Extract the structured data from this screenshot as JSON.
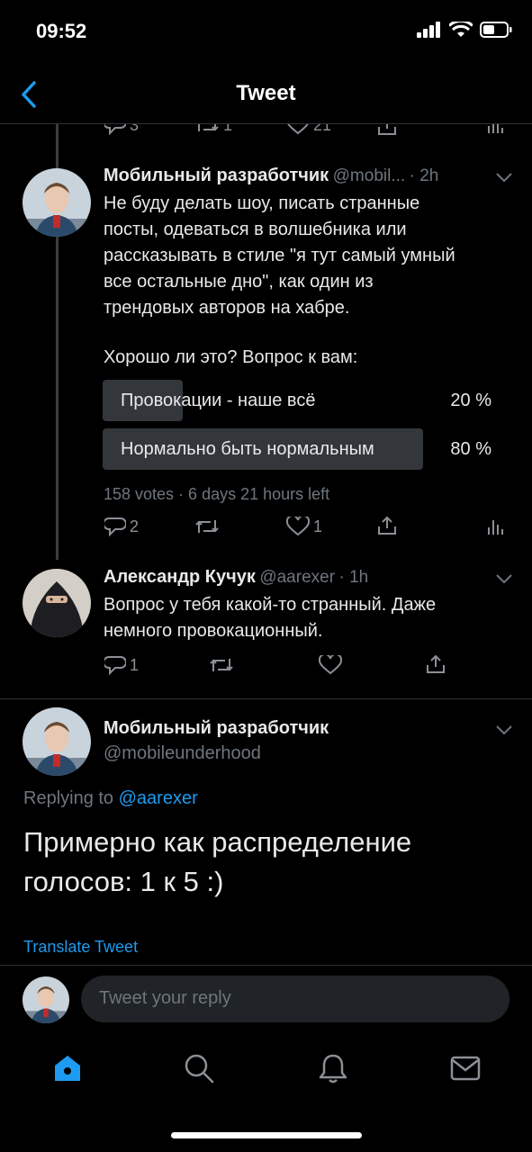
{
  "status_bar": {
    "time": "09:52"
  },
  "header": {
    "title": "Tweet"
  },
  "top_partial_actions": {
    "reply_count": "3",
    "retweet_count": "1",
    "like_count": "21"
  },
  "tweets": [
    {
      "name": "Мобильный разработчик",
      "handle": "@mobil...",
      "time": "· 2h",
      "lines": [
        "Не буду делать шоу, писать странные",
        "посты, одеваться в волшебника или",
        "рассказывать в стиле \"я тут самый умный",
        "все остальные дно\", как один из",
        "трендовых авторов на хабре."
      ],
      "question": "Хорошо ли это? Вопрос к вам:",
      "poll": {
        "options": [
          {
            "label": "Провокации - наше всё",
            "percent_text": "20 %",
            "percent": 20
          },
          {
            "label": "Нормально быть нормальным",
            "percent_text": "80 %",
            "percent": 80
          }
        ],
        "meta": "158 votes · 6 days 21 hours left"
      },
      "actions": {
        "reply_count": "2",
        "retweet_count": "",
        "like_count": "1"
      }
    },
    {
      "name": "Александр Кучук",
      "handle": "@aarexer",
      "time": "· 1h",
      "lines": [
        "Вопрос у тебя какой-то странный. Даже",
        "немного провокационный."
      ],
      "actions": {
        "reply_count": "1",
        "retweet_count": "",
        "like_count": ""
      }
    }
  ],
  "main_tweet": {
    "name": "Мобильный разработчик",
    "handle": "@mobileunderhood",
    "replying_prefix": "Replying to ",
    "replying_to": "@aarexer",
    "lines": [
      "Примерно как распределение",
      "голосов: 1 к 5 :)"
    ],
    "translate": "Translate Tweet"
  },
  "reply_box": {
    "placeholder": "Tweet your reply"
  },
  "tab_bar": [
    "home-icon",
    "search-icon",
    "notifications-icon",
    "messages-icon"
  ],
  "colors": {
    "accent": "#1d9bf0",
    "background": "#000000",
    "poll_bar": "#33373b"
  }
}
